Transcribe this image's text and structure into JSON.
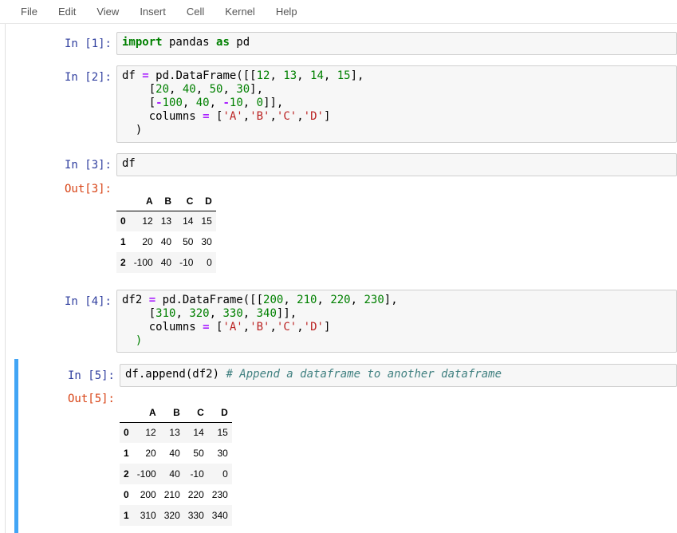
{
  "menu": [
    "File",
    "Edit",
    "View",
    "Insert",
    "Cell",
    "Kernel",
    "Help"
  ],
  "cells": [
    {
      "in_prompt": "In [1]:"
    },
    {
      "in_prompt": "In [2]:"
    },
    {
      "in_prompt": "In [3]:",
      "out_prompt": "Out[3]:"
    },
    {
      "in_prompt": "In [4]:"
    },
    {
      "in_prompt": "In [5]:",
      "out_prompt": "Out[5]:"
    }
  ],
  "code": {
    "c1": [
      "import",
      " pandas ",
      "as",
      " pd"
    ],
    "c3": "df",
    "c5_code": "df.append(df2) ",
    "c5_comment": "# Append a dataframe to another dataframe"
  },
  "out3": {
    "columns": [
      "",
      "A",
      "B",
      "C",
      "D"
    ],
    "rows": [
      [
        "0",
        "12",
        "13",
        "14",
        "15"
      ],
      [
        "1",
        "20",
        "40",
        "50",
        "30"
      ],
      [
        "2",
        "-100",
        "40",
        "-10",
        "0"
      ]
    ]
  },
  "out5": {
    "columns": [
      "",
      "A",
      "B",
      "C",
      "D"
    ],
    "rows": [
      [
        "0",
        "12",
        "13",
        "14",
        "15"
      ],
      [
        "1",
        "20",
        "40",
        "50",
        "30"
      ],
      [
        "2",
        "-100",
        "40",
        "-10",
        "0"
      ],
      [
        "0",
        "200",
        "210",
        "220",
        "230"
      ],
      [
        "1",
        "310",
        "320",
        "330",
        "340"
      ]
    ]
  },
  "colors": {
    "selected_cell_border": "#42a5f5",
    "in_prompt": "#303f9f",
    "out_prompt": "#d84315"
  }
}
